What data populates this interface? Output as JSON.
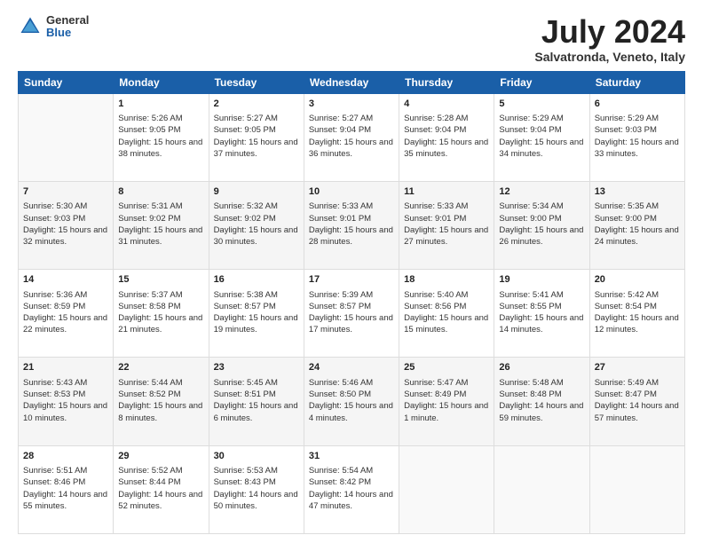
{
  "logo": {
    "general": "General",
    "blue": "Blue"
  },
  "title": "July 2024",
  "location": "Salvatronda, Veneto, Italy",
  "days_of_week": [
    "Sunday",
    "Monday",
    "Tuesday",
    "Wednesday",
    "Thursday",
    "Friday",
    "Saturday"
  ],
  "weeks": [
    [
      {
        "day": "",
        "sunrise": "",
        "sunset": "",
        "daylight": ""
      },
      {
        "day": "1",
        "sunrise": "Sunrise: 5:26 AM",
        "sunset": "Sunset: 9:05 PM",
        "daylight": "Daylight: 15 hours and 38 minutes."
      },
      {
        "day": "2",
        "sunrise": "Sunrise: 5:27 AM",
        "sunset": "Sunset: 9:05 PM",
        "daylight": "Daylight: 15 hours and 37 minutes."
      },
      {
        "day": "3",
        "sunrise": "Sunrise: 5:27 AM",
        "sunset": "Sunset: 9:04 PM",
        "daylight": "Daylight: 15 hours and 36 minutes."
      },
      {
        "day": "4",
        "sunrise": "Sunrise: 5:28 AM",
        "sunset": "Sunset: 9:04 PM",
        "daylight": "Daylight: 15 hours and 35 minutes."
      },
      {
        "day": "5",
        "sunrise": "Sunrise: 5:29 AM",
        "sunset": "Sunset: 9:04 PM",
        "daylight": "Daylight: 15 hours and 34 minutes."
      },
      {
        "day": "6",
        "sunrise": "Sunrise: 5:29 AM",
        "sunset": "Sunset: 9:03 PM",
        "daylight": "Daylight: 15 hours and 33 minutes."
      }
    ],
    [
      {
        "day": "7",
        "sunrise": "Sunrise: 5:30 AM",
        "sunset": "Sunset: 9:03 PM",
        "daylight": "Daylight: 15 hours and 32 minutes."
      },
      {
        "day": "8",
        "sunrise": "Sunrise: 5:31 AM",
        "sunset": "Sunset: 9:02 PM",
        "daylight": "Daylight: 15 hours and 31 minutes."
      },
      {
        "day": "9",
        "sunrise": "Sunrise: 5:32 AM",
        "sunset": "Sunset: 9:02 PM",
        "daylight": "Daylight: 15 hours and 30 minutes."
      },
      {
        "day": "10",
        "sunrise": "Sunrise: 5:33 AM",
        "sunset": "Sunset: 9:01 PM",
        "daylight": "Daylight: 15 hours and 28 minutes."
      },
      {
        "day": "11",
        "sunrise": "Sunrise: 5:33 AM",
        "sunset": "Sunset: 9:01 PM",
        "daylight": "Daylight: 15 hours and 27 minutes."
      },
      {
        "day": "12",
        "sunrise": "Sunrise: 5:34 AM",
        "sunset": "Sunset: 9:00 PM",
        "daylight": "Daylight: 15 hours and 26 minutes."
      },
      {
        "day": "13",
        "sunrise": "Sunrise: 5:35 AM",
        "sunset": "Sunset: 9:00 PM",
        "daylight": "Daylight: 15 hours and 24 minutes."
      }
    ],
    [
      {
        "day": "14",
        "sunrise": "Sunrise: 5:36 AM",
        "sunset": "Sunset: 8:59 PM",
        "daylight": "Daylight: 15 hours and 22 minutes."
      },
      {
        "day": "15",
        "sunrise": "Sunrise: 5:37 AM",
        "sunset": "Sunset: 8:58 PM",
        "daylight": "Daylight: 15 hours and 21 minutes."
      },
      {
        "day": "16",
        "sunrise": "Sunrise: 5:38 AM",
        "sunset": "Sunset: 8:57 PM",
        "daylight": "Daylight: 15 hours and 19 minutes."
      },
      {
        "day": "17",
        "sunrise": "Sunrise: 5:39 AM",
        "sunset": "Sunset: 8:57 PM",
        "daylight": "Daylight: 15 hours and 17 minutes."
      },
      {
        "day": "18",
        "sunrise": "Sunrise: 5:40 AM",
        "sunset": "Sunset: 8:56 PM",
        "daylight": "Daylight: 15 hours and 15 minutes."
      },
      {
        "day": "19",
        "sunrise": "Sunrise: 5:41 AM",
        "sunset": "Sunset: 8:55 PM",
        "daylight": "Daylight: 15 hours and 14 minutes."
      },
      {
        "day": "20",
        "sunrise": "Sunrise: 5:42 AM",
        "sunset": "Sunset: 8:54 PM",
        "daylight": "Daylight: 15 hours and 12 minutes."
      }
    ],
    [
      {
        "day": "21",
        "sunrise": "Sunrise: 5:43 AM",
        "sunset": "Sunset: 8:53 PM",
        "daylight": "Daylight: 15 hours and 10 minutes."
      },
      {
        "day": "22",
        "sunrise": "Sunrise: 5:44 AM",
        "sunset": "Sunset: 8:52 PM",
        "daylight": "Daylight: 15 hours and 8 minutes."
      },
      {
        "day": "23",
        "sunrise": "Sunrise: 5:45 AM",
        "sunset": "Sunset: 8:51 PM",
        "daylight": "Daylight: 15 hours and 6 minutes."
      },
      {
        "day": "24",
        "sunrise": "Sunrise: 5:46 AM",
        "sunset": "Sunset: 8:50 PM",
        "daylight": "Daylight: 15 hours and 4 minutes."
      },
      {
        "day": "25",
        "sunrise": "Sunrise: 5:47 AM",
        "sunset": "Sunset: 8:49 PM",
        "daylight": "Daylight: 15 hours and 1 minute."
      },
      {
        "day": "26",
        "sunrise": "Sunrise: 5:48 AM",
        "sunset": "Sunset: 8:48 PM",
        "daylight": "Daylight: 14 hours and 59 minutes."
      },
      {
        "day": "27",
        "sunrise": "Sunrise: 5:49 AM",
        "sunset": "Sunset: 8:47 PM",
        "daylight": "Daylight: 14 hours and 57 minutes."
      }
    ],
    [
      {
        "day": "28",
        "sunrise": "Sunrise: 5:51 AM",
        "sunset": "Sunset: 8:46 PM",
        "daylight": "Daylight: 14 hours and 55 minutes."
      },
      {
        "day": "29",
        "sunrise": "Sunrise: 5:52 AM",
        "sunset": "Sunset: 8:44 PM",
        "daylight": "Daylight: 14 hours and 52 minutes."
      },
      {
        "day": "30",
        "sunrise": "Sunrise: 5:53 AM",
        "sunset": "Sunset: 8:43 PM",
        "daylight": "Daylight: 14 hours and 50 minutes."
      },
      {
        "day": "31",
        "sunrise": "Sunrise: 5:54 AM",
        "sunset": "Sunset: 8:42 PM",
        "daylight": "Daylight: 14 hours and 47 minutes."
      },
      {
        "day": "",
        "sunrise": "",
        "sunset": "",
        "daylight": ""
      },
      {
        "day": "",
        "sunrise": "",
        "sunset": "",
        "daylight": ""
      },
      {
        "day": "",
        "sunrise": "",
        "sunset": "",
        "daylight": ""
      }
    ]
  ]
}
